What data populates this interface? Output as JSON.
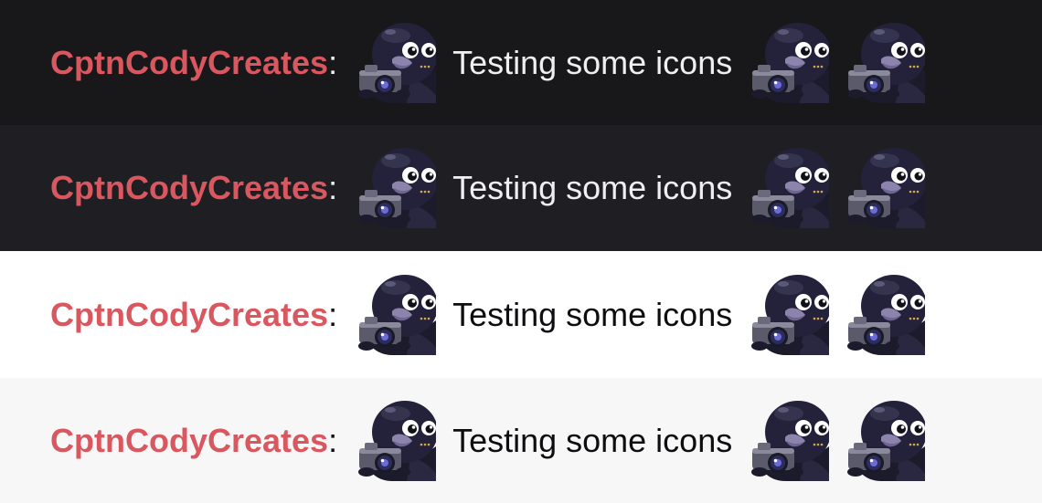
{
  "chat_lines": [
    {
      "username": "CptnCodyCreates",
      "separator": ":",
      "message": "Testing some icons",
      "background": "#18181b"
    },
    {
      "username": "CptnCodyCreates",
      "separator": ":",
      "message": "Testing some icons",
      "background": "#1f1f23"
    },
    {
      "username": "CptnCodyCreates",
      "separator": ":",
      "message": "Testing some icons",
      "background": "#ffffff"
    },
    {
      "username": "CptnCodyCreates",
      "separator": ":",
      "message": "Testing some icons",
      "background": "#f7f7f8"
    }
  ],
  "emote": {
    "icon": "crow-with-camera-icon"
  },
  "colors": {
    "username": "#d9575f",
    "text_dark_theme": "#efeff1",
    "text_light_theme": "#0e0e10"
  }
}
